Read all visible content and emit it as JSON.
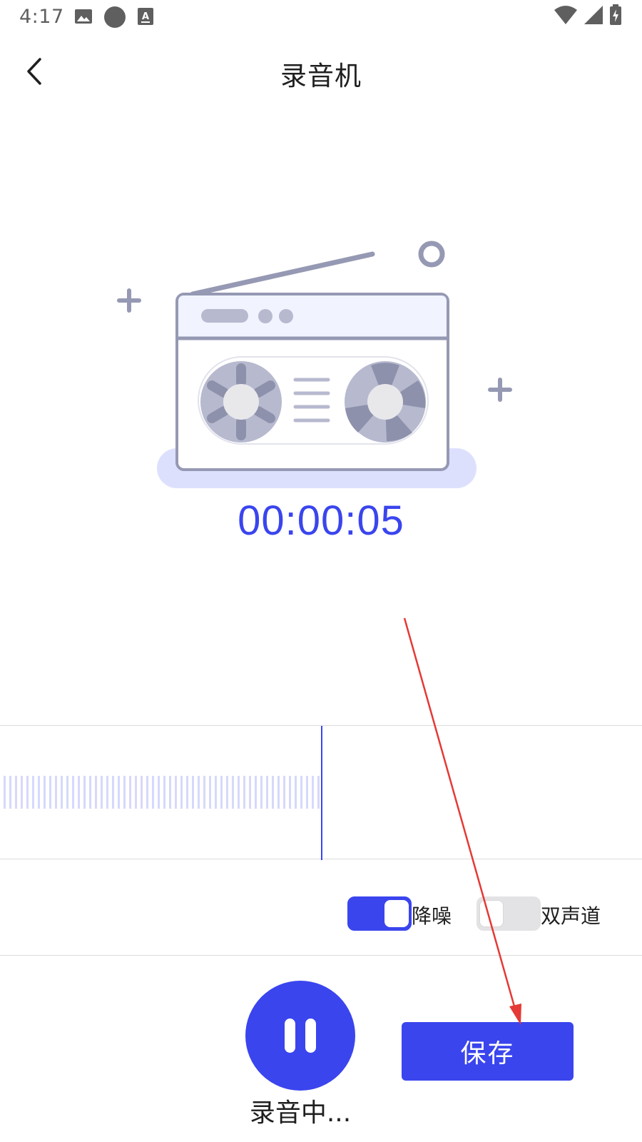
{
  "status_bar": {
    "time": "4:17",
    "icons": [
      "image-icon",
      "circle-icon",
      "text-notification-icon",
      "wifi-icon",
      "signal-icon",
      "battery-charging-icon"
    ]
  },
  "header": {
    "back_icon": "chevron-left-icon",
    "title": "录音机"
  },
  "recorder": {
    "elapsed": "00:00:05",
    "illustration": "cassette-radio-illustration"
  },
  "options": {
    "noise_reduction": {
      "label": "降噪",
      "enabled": true
    },
    "stereo": {
      "label": "双声道",
      "enabled": false
    }
  },
  "controls": {
    "pause_icon": "pause-icon",
    "status_label": "录音中...",
    "save_label": "保存"
  },
  "colors": {
    "accent": "#3a45ee",
    "illustration_stroke": "#9699b3",
    "annotation": "#e53935"
  }
}
